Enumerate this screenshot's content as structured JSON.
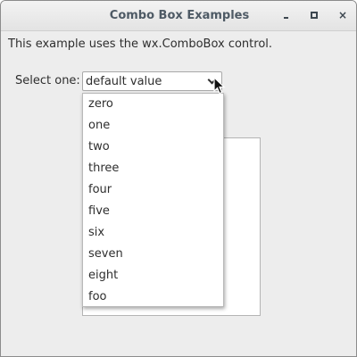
{
  "window": {
    "title": "Combo Box Examples",
    "minimize_icon": "minimize-icon",
    "maximize_icon": "maximize-icon",
    "close_glyph": "×"
  },
  "content": {
    "intro_text": "This example uses the wx.ComboBox control.",
    "select_label": "Select one:",
    "combo_value": "default value",
    "dropdown_options": [
      "zero",
      "one",
      "two",
      "three",
      "four",
      "five",
      "six",
      "seven",
      "eight",
      "foo"
    ]
  },
  "icons": {
    "combo_arrow": "chevron-down-icon",
    "pointer": "mouse-pointer-icon"
  }
}
